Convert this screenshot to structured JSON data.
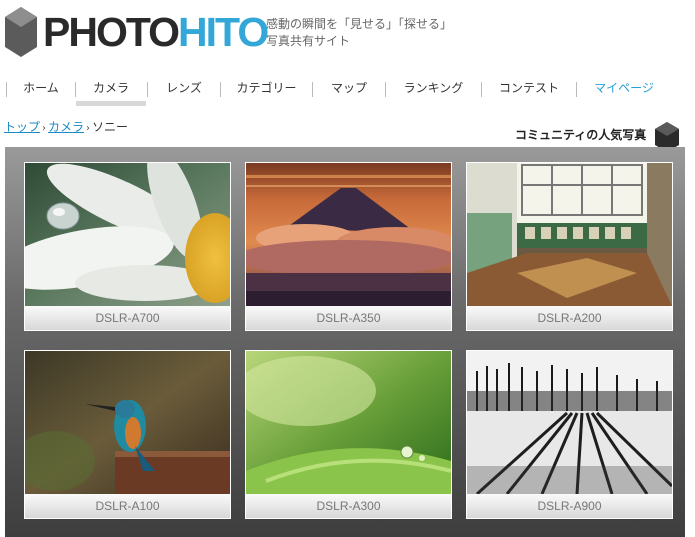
{
  "header": {
    "logo_photo": "PHOTO",
    "logo_hito": "HITO",
    "tagline_line1": "感動の瞬間を「見せる」「探せる」",
    "tagline_line2": "写真共有サイト"
  },
  "nav": {
    "items": [
      {
        "label": "ホーム"
      },
      {
        "label": "カメラ"
      },
      {
        "label": "レンズ"
      },
      {
        "label": "カテゴリー"
      },
      {
        "label": "マップ"
      },
      {
        "label": "ランキング"
      },
      {
        "label": "コンテスト"
      },
      {
        "label": "マイページ"
      }
    ],
    "active_index": 1
  },
  "breadcrumb": {
    "top": "トップ",
    "camera": "カメラ",
    "current": "ソニー",
    "separator": "›"
  },
  "section_title": "コミュニティの人気写真",
  "gallery": [
    {
      "caption": "DSLR-A700"
    },
    {
      "caption": "DSLR-A350"
    },
    {
      "caption": "DSLR-A200"
    },
    {
      "caption": "DSLR-A100"
    },
    {
      "caption": "DSLR-A300"
    },
    {
      "caption": "DSLR-A900"
    }
  ],
  "colors": {
    "brand_blue": "#33a8d8",
    "logo_dark": "#2a2a2a",
    "link": "#1a8ac6"
  }
}
